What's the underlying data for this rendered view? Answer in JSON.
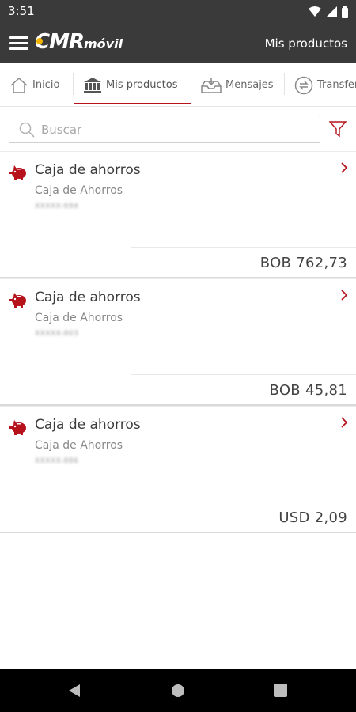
{
  "status_bar": {
    "time": "3:51",
    "icons": [
      "wifi-icon",
      "signal-icon",
      "battery-icon"
    ]
  },
  "app_bar": {
    "logo": {
      "main": "CMR",
      "suffix": "móvil"
    },
    "title": "Mis productos"
  },
  "tabs": [
    {
      "label": "Inicio",
      "icon": "home-icon",
      "active": false
    },
    {
      "label": "Mis productos",
      "icon": "bank-icon",
      "active": true
    },
    {
      "label": "Mensajes",
      "icon": "inbox-icon",
      "active": false
    },
    {
      "label": "Transferencias",
      "icon": "transfer-icon",
      "active": false
    }
  ],
  "search": {
    "placeholder": "Buscar",
    "value": ""
  },
  "products": [
    {
      "title": "Caja de ahorros",
      "subtitle": "Caja de Ahorros",
      "account": "XXXXX-694",
      "balance": "BOB 762,73"
    },
    {
      "title": "Caja de ahorros",
      "subtitle": "Caja de Ahorros",
      "account": "XXXXX-803",
      "balance": "BOB 45,81"
    },
    {
      "title": "Caja de ahorros",
      "subtitle": "Caja de Ahorros",
      "account": "XXXXX-886",
      "balance": "USD 2,09"
    }
  ],
  "colors": {
    "accent": "#b5121b",
    "header_bg": "#3a3a3a",
    "logo_dot": "#f2b400"
  }
}
